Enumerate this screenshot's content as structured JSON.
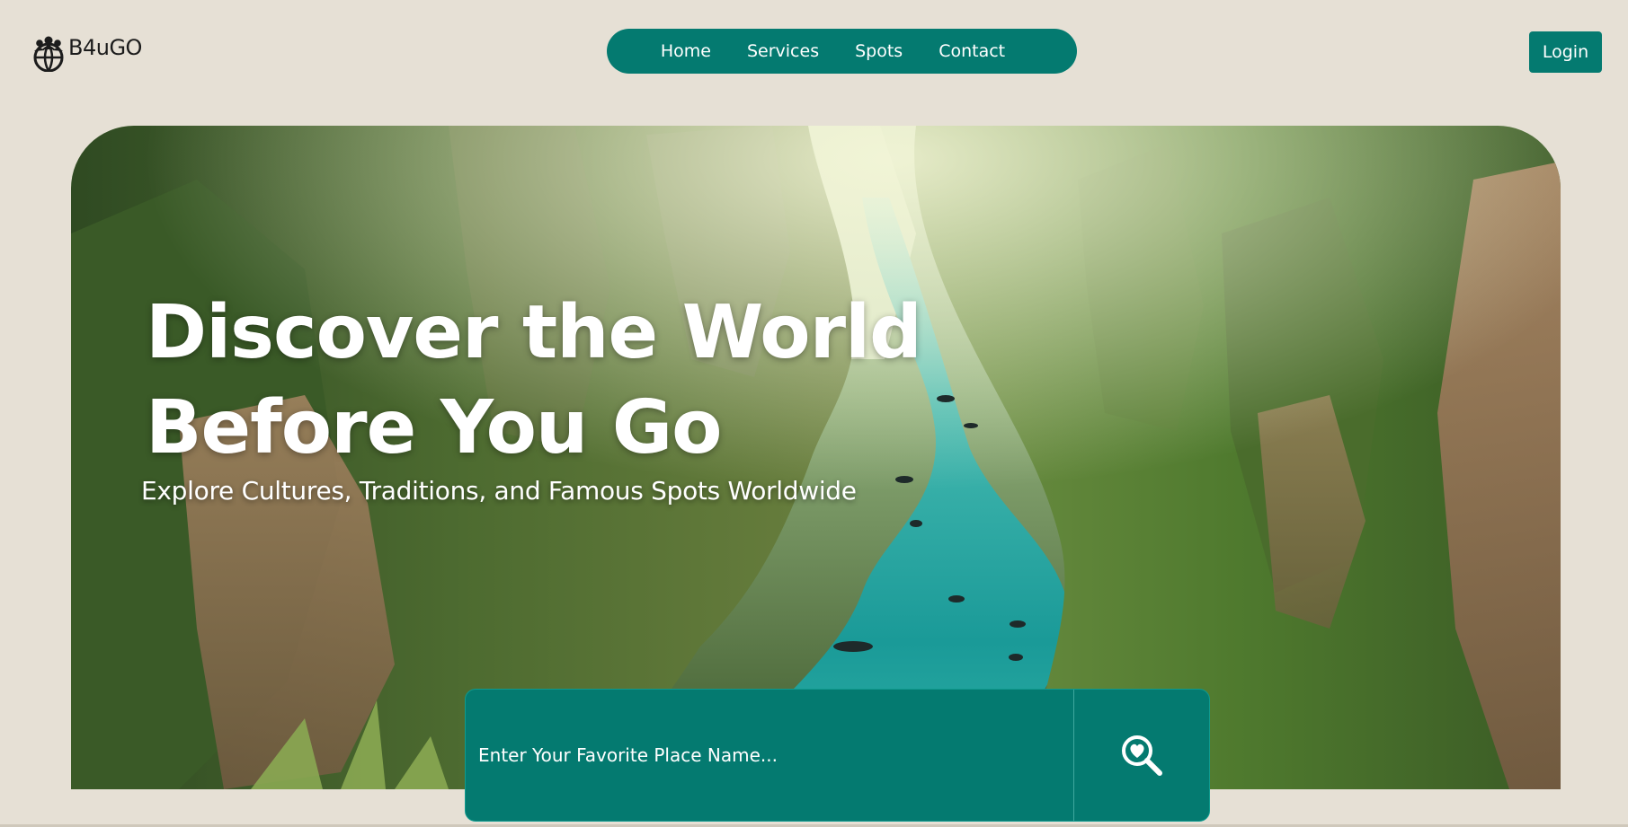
{
  "header": {
    "brand": "B4uGO",
    "logo_icon": "globe-people-icon",
    "nav": [
      {
        "label": "Home"
      },
      {
        "label": "Services"
      },
      {
        "label": "Spots"
      },
      {
        "label": "Contact"
      }
    ],
    "login_label": "Login"
  },
  "hero": {
    "title_line1": "Discover the World",
    "title_line2": "Before You Go",
    "subtitle": "Explore Cultures, Traditions, and Famous Spots Worldwide",
    "image": "canyon-river-landscape"
  },
  "search": {
    "placeholder": "Enter Your Favorite Place Name...",
    "value": "",
    "button_icon": "search-heart-icon"
  },
  "colors": {
    "accent": "#047a70",
    "background": "#e6e0d5",
    "text_light": "#ffffff"
  }
}
